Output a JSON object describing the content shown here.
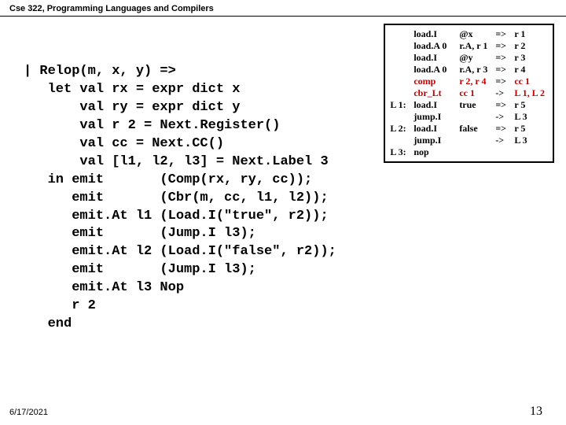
{
  "header": "Cse 322, Programming Languages and Compilers",
  "code_lines": [
    "| Relop(m, x, y) =>",
    "   let val rx = expr dict x",
    "       val ry = expr dict y",
    "       val r 2 = Next.Register()",
    "       val cc = Next.CC()",
    "       val [l1, l2, l3] = Next.Label 3",
    "   in emit       (Comp(rx, ry, cc));",
    "      emit       (Cbr(m, cc, l1, l2));",
    "      emit.At l1 (Load.I(\"true\", r2));",
    "      emit       (Jump.I l3);",
    "      emit.At l2 (Load.I(\"false\", r2));",
    "      emit       (Jump.I l3);",
    "      emit.At l3 Nop",
    "      r 2",
    "   end"
  ],
  "asm": [
    {
      "lbl": "",
      "op": "load.I",
      "arg": "@x",
      "arr": "=>",
      "res": "r 1",
      "red": false
    },
    {
      "lbl": "",
      "op": "load.A 0",
      "arg": "r.A, r 1",
      "arr": "=>",
      "res": "r 2",
      "red": false
    },
    {
      "lbl": "",
      "op": "load.I",
      "arg": "@y",
      "arr": "=>",
      "res": "r 3",
      "red": false
    },
    {
      "lbl": "",
      "op": "load.A 0",
      "arg": "r.A, r 3",
      "arr": "=>",
      "res": "r 4",
      "red": false
    },
    {
      "lbl": "",
      "op": "comp",
      "arg": "r 2, r 4",
      "arr": "=>",
      "res": "cc 1",
      "red": true
    },
    {
      "lbl": "",
      "op": "cbr_Lt",
      "arg": "cc 1",
      "arr": "->",
      "res": "L 1, L 2",
      "red": true
    },
    {
      "lbl": "L 1:",
      "op": "load.I",
      "arg": "true",
      "arr": "=>",
      "res": "r 5",
      "red": false
    },
    {
      "lbl": "",
      "op": "jump.I",
      "arg": "",
      "arr": "->",
      "res": "L 3",
      "red": false
    },
    {
      "lbl": "L 2:",
      "op": "load.I",
      "arg": "false",
      "arr": "=>",
      "res": "r 5",
      "red": false
    },
    {
      "lbl": "",
      "op": "jump.I",
      "arg": "",
      "arr": "->",
      "res": "L 3",
      "red": false
    },
    {
      "lbl": "L 3:",
      "op": "nop",
      "arg": "",
      "arr": "",
      "res": "",
      "red": false
    }
  ],
  "footer": {
    "date": "6/17/2021",
    "page": "13"
  }
}
